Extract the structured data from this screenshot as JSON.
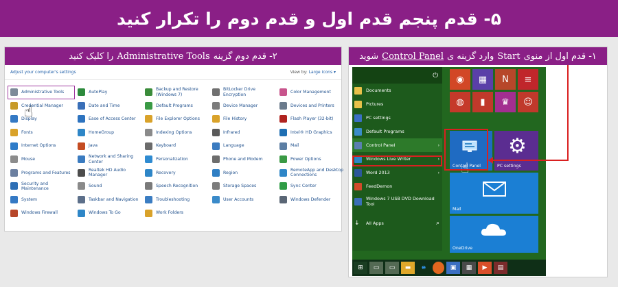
{
  "title": "۵- قدم پنجم قدم اول و قدم دوم را تکرار کنید",
  "left_panel": {
    "heading_pre": "۲- قدم دوم گزینه",
    "heading_en": "Administrative Tools",
    "heading_post": "را کلیک کنید",
    "header_link": "Adjust your computer's settings",
    "view_by": "View by:",
    "view_value": "Large icons ▾",
    "items": [
      {
        "label": "Administrative Tools",
        "color": "#7d8a99"
      },
      {
        "label": "AutoPlay",
        "color": "#2c8a3c"
      },
      {
        "label": "Backup and Restore (Windows 7)",
        "color": "#3b8c3b"
      },
      {
        "label": "BitLocker Drive Encryption",
        "color": "#707070"
      },
      {
        "label": "Color Management",
        "color": "#c8548c"
      },
      {
        "label": "Credential Manager",
        "color": "#c79a28"
      },
      {
        "label": "Date and Time",
        "color": "#3a6fb8"
      },
      {
        "label": "Default Programs",
        "color": "#3a9a45"
      },
      {
        "label": "Device Manager",
        "color": "#7c7c7c"
      },
      {
        "label": "Devices and Printers",
        "color": "#6b7b8c"
      },
      {
        "label": "Display",
        "color": "#3479c4"
      },
      {
        "label": "Ease of Access Center",
        "color": "#2d73bf"
      },
      {
        "label": "File Explorer Options",
        "color": "#d9a22a"
      },
      {
        "label": "File History",
        "color": "#d9a22a"
      },
      {
        "label": "Flash Player (32-bit)",
        "color": "#b0231f"
      },
      {
        "label": "Fonts",
        "color": "#d9a22a"
      },
      {
        "label": "HomeGroup",
        "color": "#2e86c7"
      },
      {
        "label": "Indexing Options",
        "color": "#8a8a8a"
      },
      {
        "label": "Infrared",
        "color": "#5a5a5a"
      },
      {
        "label": "Intel® HD Graphics",
        "color": "#1f6fb3"
      },
      {
        "label": "Internet Options",
        "color": "#2e7cc9"
      },
      {
        "label": "Java",
        "color": "#c44c22"
      },
      {
        "label": "Keyboard",
        "color": "#6b6b6b"
      },
      {
        "label": "Language",
        "color": "#3a7bc0"
      },
      {
        "label": "Mail",
        "color": "#5c7ea3"
      },
      {
        "label": "Mouse",
        "color": "#8c8c8c"
      },
      {
        "label": "Network and Sharing Center",
        "color": "#3a7bc0"
      },
      {
        "label": "Personalization",
        "color": "#2f8bd1"
      },
      {
        "label": "Phone and Modem",
        "color": "#6d6d6d"
      },
      {
        "label": "Power Options",
        "color": "#3a9a45"
      },
      {
        "label": "Programs and Features",
        "color": "#6b7fa0"
      },
      {
        "label": "Realtek HD Audio Manager",
        "color": "#4c4c4c"
      },
      {
        "label": "Recovery",
        "color": "#2e86c7"
      },
      {
        "label": "Region",
        "color": "#2f7fc4"
      },
      {
        "label": "RemoteApp and Desktop Connections",
        "color": "#2e86c7"
      },
      {
        "label": "Security and Maintenance",
        "color": "#2e6fb5"
      },
      {
        "label": "Sound",
        "color": "#8a8a8a"
      },
      {
        "label": "Speech Recognition",
        "color": "#7a7a7a"
      },
      {
        "label": "Storage Spaces",
        "color": "#7c7c7c"
      },
      {
        "label": "Sync Center",
        "color": "#2f9c45"
      },
      {
        "label": "System",
        "color": "#3479c4"
      },
      {
        "label": "Taskbar and Navigation",
        "color": "#5c6f8a"
      },
      {
        "label": "Troubleshooting",
        "color": "#3b7dc2"
      },
      {
        "label": "User Accounts",
        "color": "#3a8ac9"
      },
      {
        "label": "Windows Defender",
        "color": "#5a6675"
      },
      {
        "label": "Windows Firewall",
        "color": "#b7472a"
      },
      {
        "label": "Windows To Go",
        "color": "#2e86c7"
      },
      {
        "label": "Work Folders",
        "color": "#d9a22a"
      }
    ]
  },
  "right_panel": {
    "heading_pre": "۱- قدم اول از منوی",
    "heading_start": "Start",
    "heading_mid": "وارد گزینه ی",
    "heading_en": "Control Panel",
    "heading_post": "شوید",
    "power_glyph": "⏻",
    "menu_items": [
      {
        "label": "Documents",
        "color": "#e8c14a",
        "arrow": ""
      },
      {
        "label": "Pictures",
        "color": "#e8c14a",
        "arrow": ""
      },
      {
        "label": "PC settings",
        "color": "#3a6fc4",
        "arrow": ""
      },
      {
        "label": "Default Programs",
        "color": "#3a8cc9",
        "arrow": ""
      },
      {
        "label": "Control Panel",
        "color": "#5a7fb0",
        "arrow": "›"
      },
      {
        "label": "Windows Live Writer",
        "color": "#2e86c7",
        "arrow": "›"
      },
      {
        "label": "Word 2013",
        "color": "#2b579a",
        "arrow": "›"
      },
      {
        "label": "FeedDemon",
        "color": "#d14a2a",
        "arrow": ""
      },
      {
        "label": "Windows 7 USB DVD Download Tool",
        "color": "#3a6fb8",
        "arrow": ""
      },
      {
        "label": "All Apps",
        "color": "#ffffff",
        "arrow": ""
      }
    ],
    "search_glyph": "⌕",
    "tiles": {
      "control_panel": "Control Panel",
      "pc_settings": "PC settings",
      "mail": "Mail",
      "onedrive": "OneDrive"
    },
    "tile_colors": {
      "row1": [
        "#d24726",
        "#5a3fa8",
        "#b7472a",
        "#c0262b"
      ],
      "row2": [
        "#c5392a",
        "#c0392b",
        "#a32e90",
        "#c0392b"
      ],
      "control_panel": "#1f6bc2",
      "pc_settings": "#5b2d91",
      "mail": "#1b7fd4",
      "onedrive": "#1b7fd4"
    }
  }
}
